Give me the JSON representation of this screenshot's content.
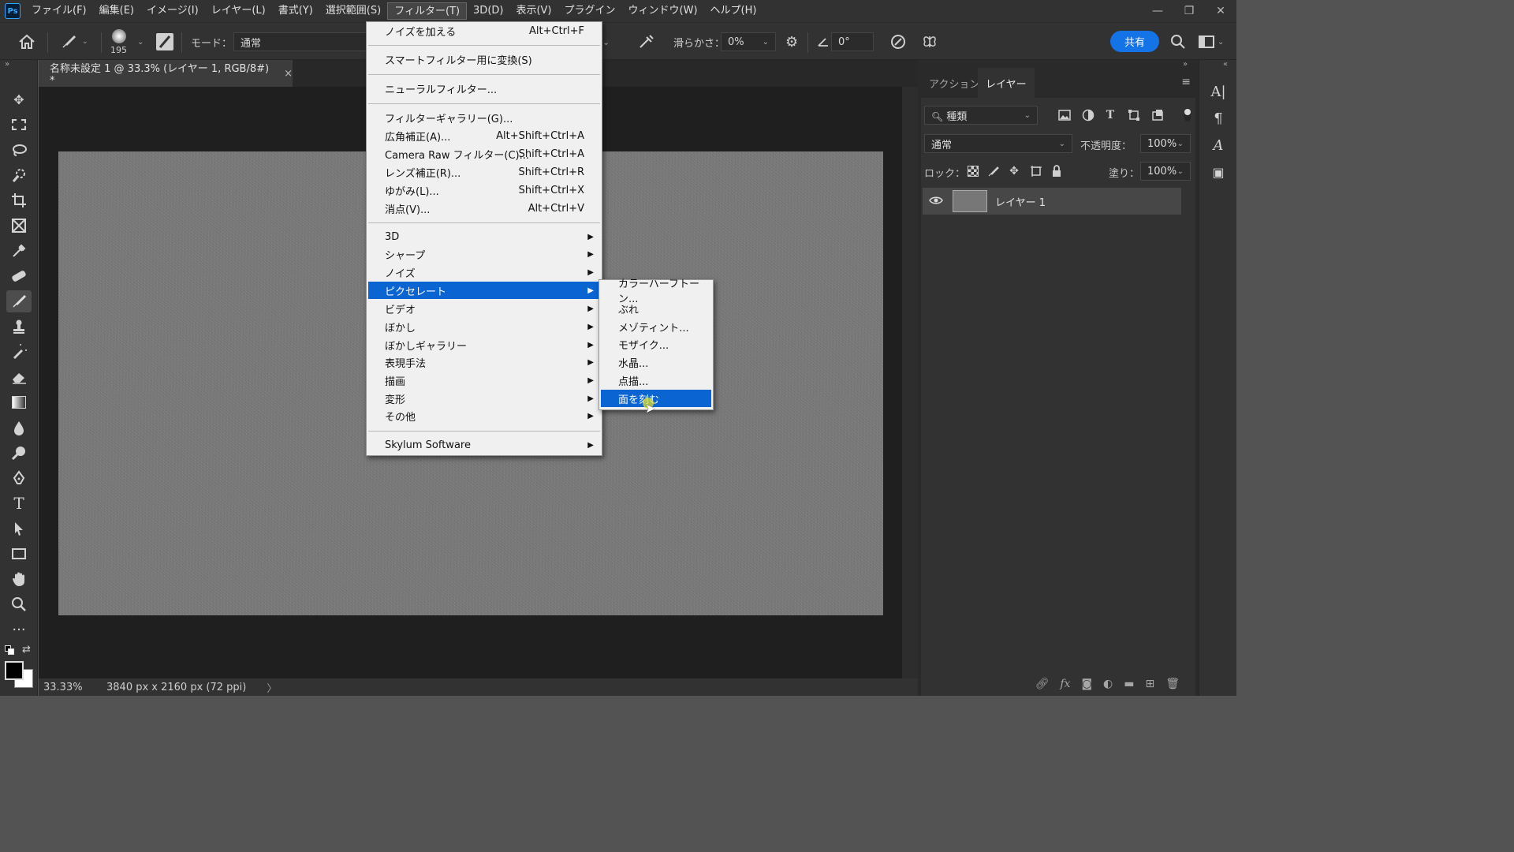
{
  "menubar": {
    "logo": "Ps",
    "items": [
      "ファイル(F)",
      "編集(E)",
      "イメージ(I)",
      "レイヤー(L)",
      "書式(Y)",
      "選択範囲(S)",
      "フィルター(T)",
      "3D(D)",
      "表示(V)",
      "プラグイン",
      "ウィンドウ(W)",
      "ヘルプ(H)"
    ],
    "active_item": "フィルター(T)"
  },
  "options": {
    "brush_size": "195",
    "mode_label": "モード：",
    "mode_value": "通常",
    "smoothing_label": "滑らかさ：",
    "smoothing_value": "0%",
    "angle_value": "0°",
    "share_label": "共有"
  },
  "document": {
    "tab_title": "名称未設定 1 @ 33.3% (レイヤー 1, RGB/8#) *",
    "close": "×"
  },
  "status": {
    "zoom": "33.33%",
    "doc_info": "3840 px x 2160 px (72 ppi)",
    "arrow": "〉"
  },
  "layers_panel": {
    "tabs": [
      "アクション",
      "レイヤー"
    ],
    "active_tab": "レイヤー",
    "filter_kind": "種類",
    "blend_mode": "通常",
    "opacity_label": "不透明度：",
    "opacity_value": "100%",
    "lock_label": "ロック：",
    "fill_label": "塗り：",
    "fill_value": "100%",
    "layers": [
      {
        "name": "レイヤー 1",
        "visible": true
      }
    ]
  },
  "filter_menu": {
    "items": [
      {
        "label": "ノイズを加える",
        "shortcut": "Alt+Ctrl+F"
      },
      {
        "label": "スマートフィルター用に変換(S)",
        "shortcut": ""
      },
      {
        "label": "ニューラルフィルター...",
        "shortcut": ""
      },
      {
        "label": "フィルターギャラリー(G)...",
        "shortcut": ""
      },
      {
        "label": "広角補正(A)...",
        "shortcut": "Alt+Shift+Ctrl+A"
      },
      {
        "label": "Camera Raw フィルター(C)...",
        "shortcut": "Shift+Ctrl+A"
      },
      {
        "label": "レンズ補正(R)...",
        "shortcut": "Shift+Ctrl+R"
      },
      {
        "label": "ゆがみ(L)...",
        "shortcut": "Shift+Ctrl+X"
      },
      {
        "label": "消点(V)...",
        "shortcut": "Alt+Ctrl+V"
      },
      {
        "label": "3D",
        "shortcut": ""
      },
      {
        "label": "シャープ",
        "shortcut": ""
      },
      {
        "label": "ノイズ",
        "shortcut": ""
      },
      {
        "label": "ピクセレート",
        "shortcut": ""
      },
      {
        "label": "ビデオ",
        "shortcut": ""
      },
      {
        "label": "ぼかし",
        "shortcut": ""
      },
      {
        "label": "ぼかしギャラリー",
        "shortcut": ""
      },
      {
        "label": "表現手法",
        "shortcut": ""
      },
      {
        "label": "描画",
        "shortcut": ""
      },
      {
        "label": "変形",
        "shortcut": ""
      },
      {
        "label": "その他",
        "shortcut": ""
      },
      {
        "label": "Skylum Software",
        "shortcut": ""
      }
    ],
    "highlighted": "ピクセレート"
  },
  "pixelate_submenu": {
    "items": [
      "カラーハーフトーン...",
      "ぶれ",
      "メゾティント...",
      "モザイク...",
      "水晶...",
      "点描...",
      "面を刻む"
    ],
    "highlighted": "面を刻む"
  },
  "colors": {
    "accent": "#1473e6",
    "menu_highlight": "#0a64d2",
    "app_bg": "#323232",
    "canvas_bg": "#1f1f1f"
  }
}
